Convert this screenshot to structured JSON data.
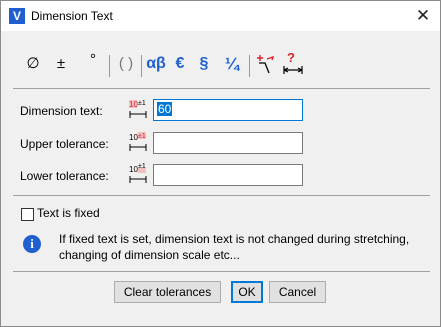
{
  "window": {
    "title": "Dimension Text",
    "app_icon_letter": "V",
    "close_glyph": "✕"
  },
  "toolbar": {
    "diameter": "∅",
    "plus_minus": "±",
    "degree": "°",
    "parentheses": "( )",
    "alpha_beta": "αβ",
    "euro": "€",
    "section": "§",
    "fraction": "¼",
    "help": "?"
  },
  "fields": {
    "dimension_text": {
      "label": "Dimension text:",
      "value": "60"
    },
    "upper_tolerance": {
      "label": "Upper tolerance:",
      "value": ""
    },
    "lower_tolerance": {
      "label": "Lower tolerance:",
      "value": ""
    }
  },
  "options": {
    "text_is_fixed": {
      "label": "Text is fixed",
      "checked": false
    }
  },
  "info": {
    "text": "If fixed text is set, dimension text is not changed during stretching, changing of dimension scale etc..."
  },
  "buttons": {
    "clear": "Clear tolerances",
    "ok": "OK",
    "cancel": "Cancel"
  },
  "colors": {
    "accent": "#1f5fd0",
    "focus": "#0078d7",
    "icon_red": "#d9232a"
  }
}
